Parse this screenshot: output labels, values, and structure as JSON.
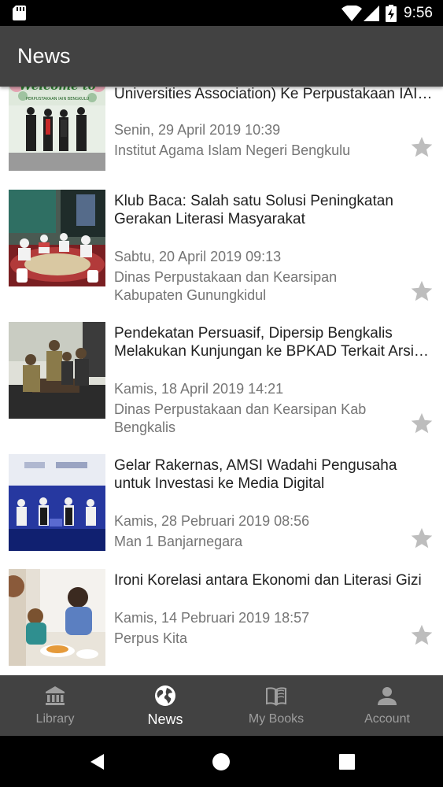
{
  "status_bar": {
    "time": "9:56",
    "icons": [
      "sd-card-icon",
      "wifi-icon",
      "signal-icon",
      "battery-charging-icon"
    ]
  },
  "app_bar": {
    "title": "News"
  },
  "news": [
    {
      "title": "Kunjungan Peserta AIUA (Asian Islamic Universities Association) Ke Perpustakaan IAIN Bengkulu",
      "date": "Senin, 29 April 2019 10:39",
      "source": "Institut Agama Islam Negeri Bengkulu",
      "thumb_text": "Welcome to",
      "thumb_subtext": "PERPUSTAKAAN IAIN BENGKULU"
    },
    {
      "title": "Klub Baca: Salah satu Solusi Peningkatan Gerakan Literasi Masyarakat",
      "date": "Sabtu, 20 April 2019 09:13",
      "source": "Dinas Perpustakaan dan Kearsipan Kabupaten Gunungkidul"
    },
    {
      "title": "Pendekatan Persuasif, Dipersip Bengkalis Melakukan Kunjungan ke BPKAD Terkait Arsip Daerah",
      "date": "Kamis, 18 April 2019 14:21",
      "source": "Dinas Perpustakaan dan Kearsipan Kab Bengkalis"
    },
    {
      "title": "Gelar Rakernas, AMSI Wadahi Pengusaha untuk Investasi ke Media Digital",
      "date": "Kamis, 28 Pebruari 2019 08:56",
      "source": "Man 1 Banjarnegara"
    },
    {
      "title": "Ironi Korelasi antara Ekonomi dan Literasi Gizi",
      "date": "Kamis, 14 Pebruari 2019 18:57",
      "source": "Perpus Kita"
    }
  ],
  "bottom_nav": {
    "active": "News",
    "items": [
      {
        "label": "Library",
        "icon": "library-icon"
      },
      {
        "label": "News",
        "icon": "globe-icon"
      },
      {
        "label": "My Books",
        "icon": "book-icon"
      },
      {
        "label": "Account",
        "icon": "person-icon"
      }
    ]
  },
  "colors": {
    "app_bar": "#424242",
    "status_bar": "#000000",
    "secondary_text": "#757575",
    "star": "#bdbdbd",
    "nav_inactive": "#9e9e9e",
    "nav_active": "#ffffff"
  }
}
